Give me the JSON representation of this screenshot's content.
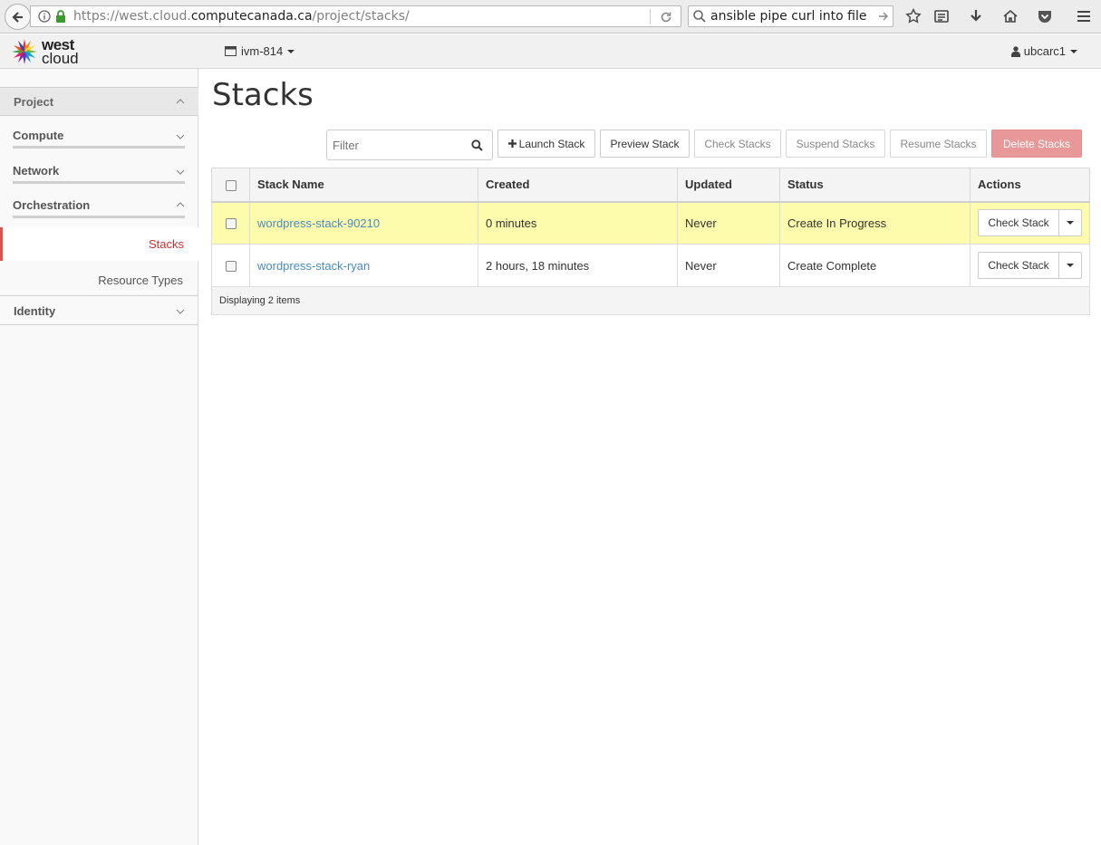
{
  "browser": {
    "url_prefix": "https://west.cloud.",
    "url_domain": "computecanada.ca",
    "url_path": "/project/stacks/",
    "search_query": "ansible pipe curl into file"
  },
  "header": {
    "logo_line1": "west",
    "logo_line2": "cloud",
    "project": "ivm-814",
    "user": "ubcarc1"
  },
  "sidebar": {
    "project": "Project",
    "compute": "Compute",
    "network": "Network",
    "orchestration": "Orchestration",
    "stacks": "Stacks",
    "resource_types": "Resource Types",
    "identity": "Identity"
  },
  "main": {
    "title": "Stacks",
    "filter_placeholder": "Filter",
    "buttons": {
      "launch": "Launch Stack",
      "preview": "Preview Stack",
      "check": "Check Stacks",
      "suspend": "Suspend Stacks",
      "resume": "Resume Stacks",
      "delete": "Delete Stacks"
    },
    "columns": [
      "Stack Name",
      "Created",
      "Updated",
      "Status",
      "Actions"
    ],
    "rows": [
      {
        "name": "wordpress-stack-90210",
        "created": "0 minutes",
        "updated": "Never",
        "status": "Create In Progress",
        "action": "Check Stack"
      },
      {
        "name": "wordpress-stack-ryan",
        "created": "2 hours, 18 minutes",
        "updated": "Never",
        "status": "Create Complete",
        "action": "Check Stack"
      }
    ],
    "footer": "Displaying 2 items"
  },
  "colors": {
    "accent_red": "#d9534f",
    "row_warning": "#fcfcac",
    "link": "#4a8bc2"
  }
}
